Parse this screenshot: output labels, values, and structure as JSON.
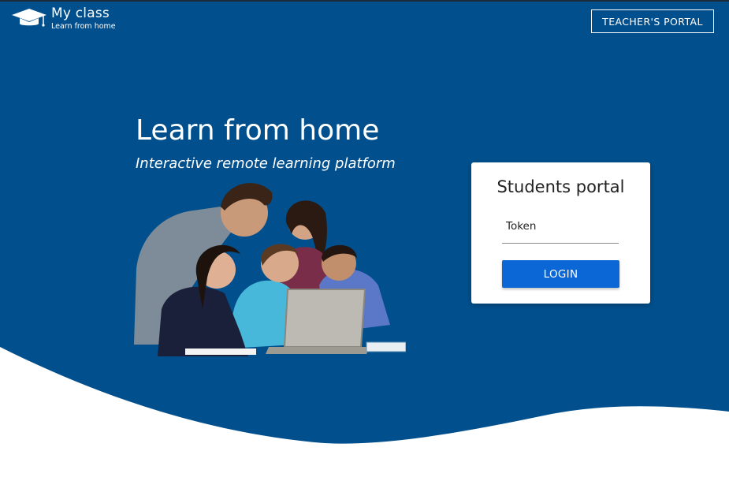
{
  "colors": {
    "primary": "#014f8c",
    "button": "#0b66d6",
    "background": "#ffffff"
  },
  "header": {
    "brand_title": "My class",
    "brand_subtitle": "Learn from home",
    "brand_icon": "graduation-cap-icon",
    "teacher_button": "TEACHER'S PORTAL"
  },
  "hero": {
    "title": "Learn from home",
    "subtitle": "Interactive remote learning platform"
  },
  "login_card": {
    "title": "Students portal",
    "token_label": "Token",
    "token_value": "",
    "login_button": "LOGIN"
  }
}
